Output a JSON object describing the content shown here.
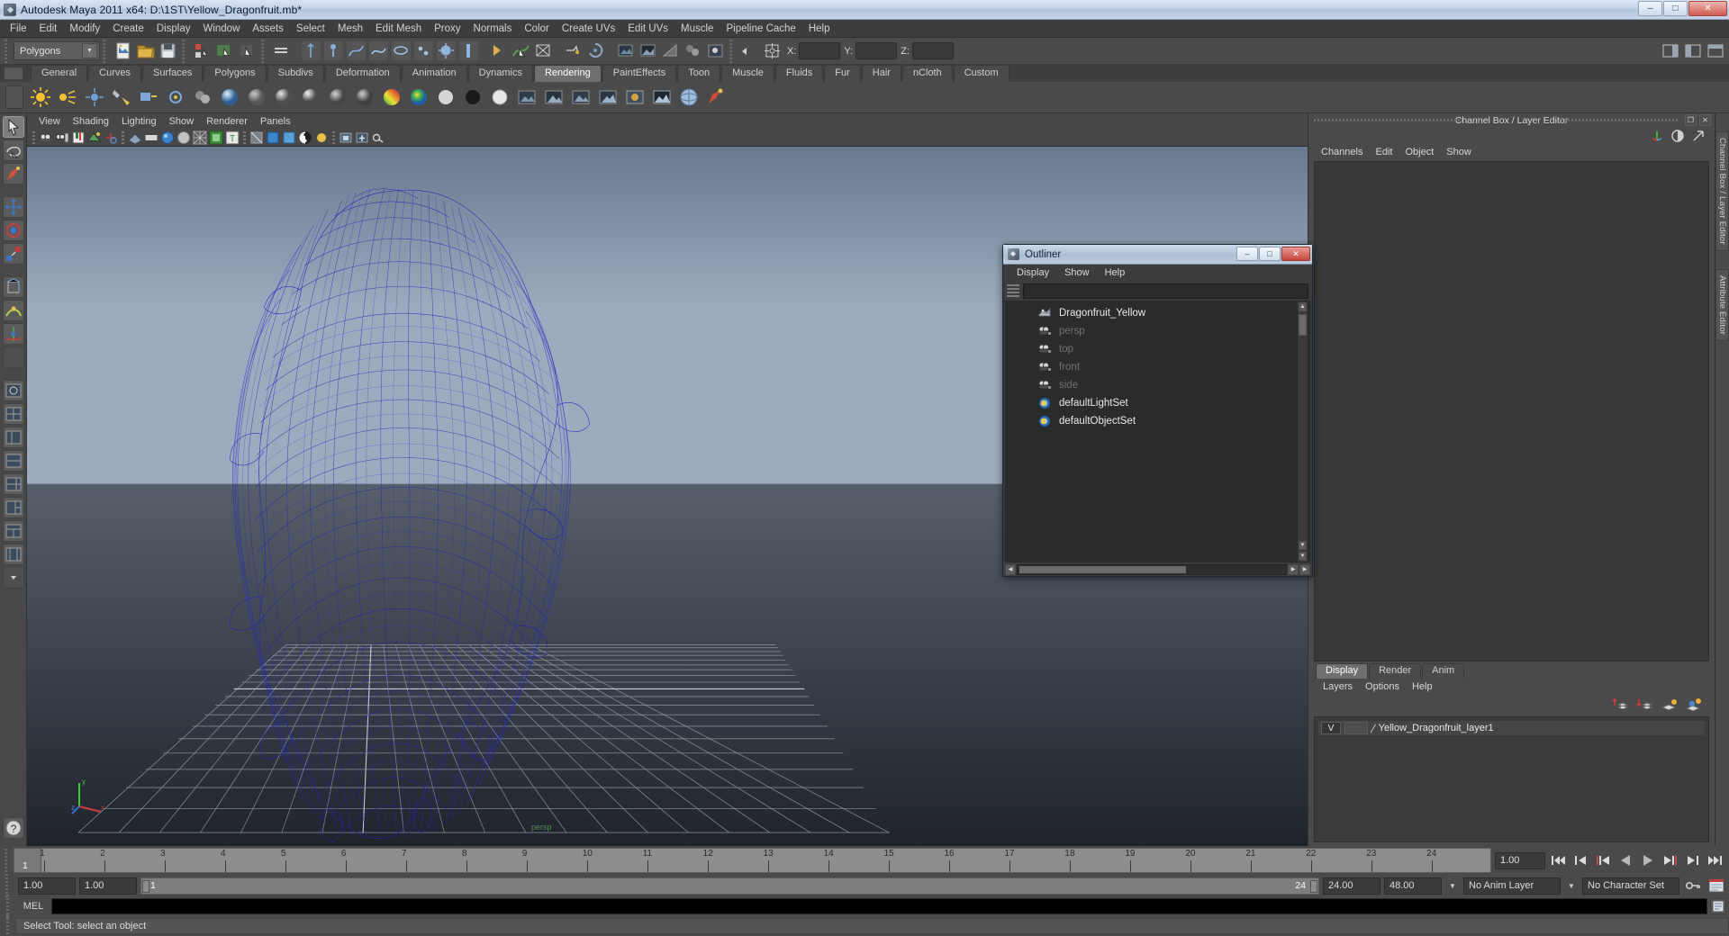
{
  "window": {
    "title": "Autodesk Maya 2011 x64: D:\\1ST\\Yellow_Dragonfruit.mb*",
    "minimize": "–",
    "maximize": "□",
    "close": "✕"
  },
  "menubar": [
    "File",
    "Edit",
    "Modify",
    "Create",
    "Display",
    "Window",
    "Assets",
    "Select",
    "Mesh",
    "Edit Mesh",
    "Proxy",
    "Normals",
    "Color",
    "Create UVs",
    "Edit UVs",
    "Muscle",
    "Pipeline Cache",
    "Help"
  ],
  "statusline": {
    "mode_selector": "Polygons",
    "x_label": "X:",
    "y_label": "Y:",
    "z_label": "Z:",
    "x_value": "",
    "y_value": "",
    "z_value": ""
  },
  "shelf": {
    "tabs": [
      "General",
      "Curves",
      "Surfaces",
      "Polygons",
      "Subdivs",
      "Deformation",
      "Animation",
      "Dynamics",
      "Rendering",
      "PaintEffects",
      "Toon",
      "Muscle",
      "Fluids",
      "Fur",
      "Hair",
      "nCloth",
      "Custom"
    ],
    "active_tab": "Rendering"
  },
  "viewport": {
    "menus": [
      "View",
      "Shading",
      "Lighting",
      "Show",
      "Renderer",
      "Panels"
    ],
    "camera_label": "persp",
    "axis": {
      "x": "x",
      "y": "y",
      "z": "z"
    }
  },
  "outliner": {
    "title": "Outliner",
    "minimize": "–",
    "maximize": "□",
    "close": "✕",
    "menus": [
      "Display",
      "Show",
      "Help"
    ],
    "search_value": "",
    "items": [
      {
        "name": "Dragonfruit_Yellow",
        "icon": "mesh-icon",
        "dim": false
      },
      {
        "name": "persp",
        "icon": "camera-icon",
        "dim": true
      },
      {
        "name": "top",
        "icon": "camera-icon",
        "dim": true
      },
      {
        "name": "front",
        "icon": "camera-icon",
        "dim": true
      },
      {
        "name": "side",
        "icon": "camera-icon",
        "dim": true
      },
      {
        "name": "defaultLightSet",
        "icon": "set-icon",
        "dim": false
      },
      {
        "name": "defaultObjectSet",
        "icon": "set-icon",
        "dim": false
      }
    ]
  },
  "channel_box": {
    "panel_title": "Channel Box / Layer Editor",
    "restore": "❐",
    "close": "✕",
    "menus": [
      "Channels",
      "Edit",
      "Object",
      "Show"
    ]
  },
  "layer_editor": {
    "tabs": [
      "Display",
      "Render",
      "Anim"
    ],
    "active_tab": "Display",
    "menus": [
      "Layers",
      "Options",
      "Help"
    ],
    "layers": [
      {
        "visibility": "V",
        "display_type": "",
        "name": "Yellow_Dragonfruit_layer1"
      }
    ]
  },
  "vertical_tabs": [
    "Channel Box / Layer Editor",
    "Attribute Editor"
  ],
  "timeslider": {
    "ticks": [
      "1",
      "2",
      "3",
      "4",
      "5",
      "6",
      "7",
      "8",
      "9",
      "10",
      "11",
      "12",
      "13",
      "14",
      "15",
      "16",
      "17",
      "18",
      "19",
      "20",
      "21",
      "22",
      "23",
      "24"
    ],
    "current_frame": "1",
    "current_frame_field": "1.00",
    "playback_buttons": [
      "go-to-start",
      "step-back-key",
      "step-back-frame",
      "play-backwards",
      "play-forwards",
      "step-forward-frame",
      "step-forward-key",
      "go-to-end"
    ]
  },
  "rangeslider": {
    "anim_start": "1.00",
    "range_start": "1.00",
    "bar_start": "1",
    "bar_end": "24",
    "range_end": "24.00",
    "anim_end": "48.00",
    "anim_layer": "No Anim Layer",
    "character_set": "No Character Set"
  },
  "command_line": {
    "label": "MEL",
    "value": ""
  },
  "statusbar": {
    "message": "Select Tool: select an object"
  },
  "colors": {
    "wireframe": "#2222b8",
    "title_accent": "#c3d2e6",
    "close_red": "#c4493f",
    "panel_bg": "#4a4a4a"
  }
}
